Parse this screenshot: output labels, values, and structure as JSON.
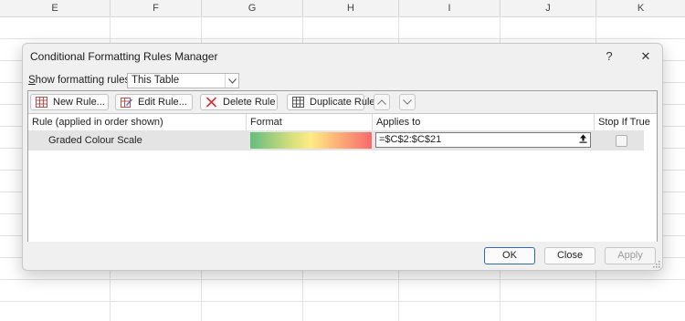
{
  "spreadsheet": {
    "columns": [
      "E",
      "F",
      "G",
      "H",
      "I",
      "J",
      "K"
    ]
  },
  "dialog": {
    "title": "Conditional Formatting Rules Manager",
    "help_label": "?",
    "close_label": "✕",
    "show_for_prefix": "S",
    "show_for_rest": "how formatting rules for:",
    "show_for_value": "This Table"
  },
  "toolbar": {
    "new_rule": "New Rule...",
    "edit_rule": "Edit Rule...",
    "delete_rule": "Delete Rule",
    "duplicate_rule": "Duplicate Rule"
  },
  "list": {
    "headers": {
      "rule": "Rule (applied in order shown)",
      "format": "Format",
      "applies_to": "Applies to",
      "stop_if_true": "Stop If True"
    },
    "rows": [
      {
        "rule": "Graded Colour Scale",
        "applies_to": "=$C$2:$C$21",
        "stop_if_true": false
      }
    ]
  },
  "buttons": {
    "ok": "OK",
    "close": "Close",
    "apply": "Apply"
  },
  "colors": {
    "scale_min": "#63be7b",
    "scale_mid": "#ffeb84",
    "scale_max": "#f8696b",
    "selection": "#e4e4e4",
    "ok_border": "#2b6cb5"
  }
}
